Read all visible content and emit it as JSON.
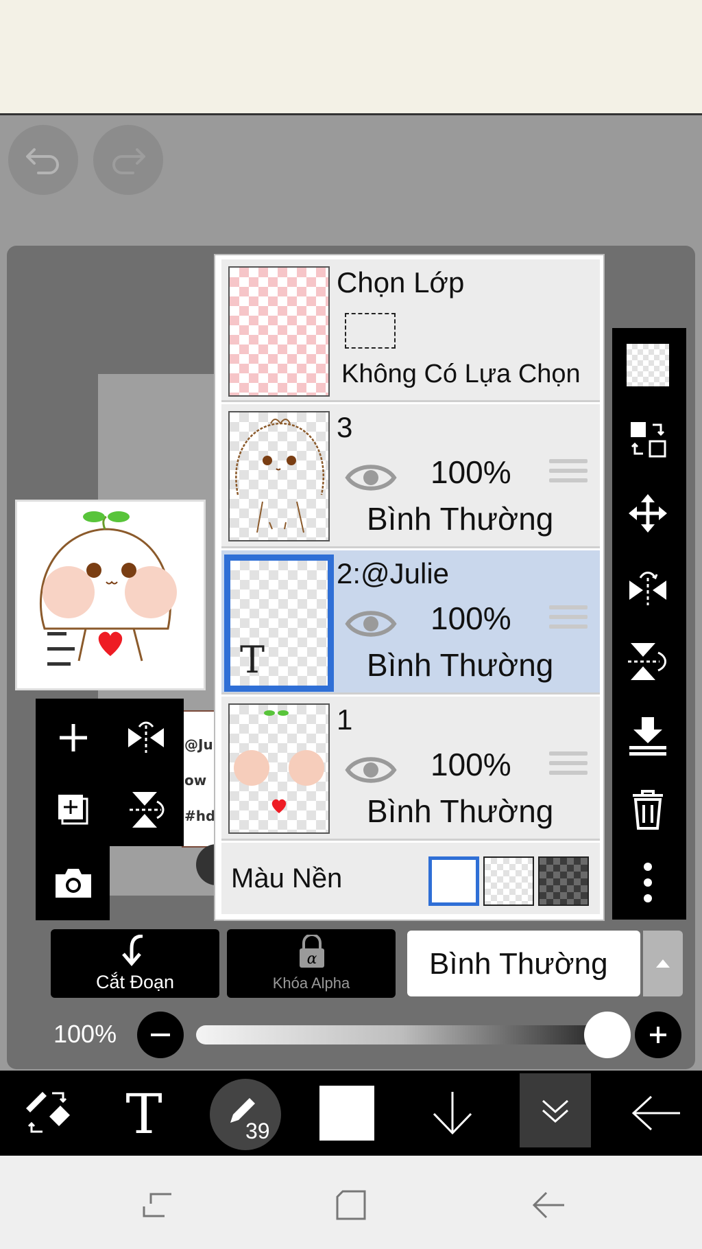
{
  "layer_select": {
    "title": "Chọn Lớp",
    "no_selection": "Không Có Lựa Chọn"
  },
  "layers": [
    {
      "name": "3",
      "opacity": "100%",
      "blend": "Bình Thường"
    },
    {
      "name": "2:@Julie",
      "opacity": "100%",
      "blend": "Bình Thường",
      "selected": true,
      "type_icon": "T"
    },
    {
      "name": "1",
      "opacity": "100%",
      "blend": "Bình Thường"
    }
  ],
  "background": {
    "label": "Màu Nền"
  },
  "actions": {
    "clip_label": "Cắt Đoạn",
    "alpha_lock_label": "Khóa Alpha",
    "blend_mode": "Bình Thường"
  },
  "opacity_slider": {
    "label": "100%",
    "value": 1.0
  },
  "brush": {
    "size": "39"
  },
  "canvas_snippets": [
    "@Ju",
    "ow",
    "#hd"
  ],
  "colors": {
    "selected_border": "#2f6fd6",
    "selected_row": "#c9d7ec",
    "panel_bg": "#ececec",
    "toolbar": "#000000"
  }
}
